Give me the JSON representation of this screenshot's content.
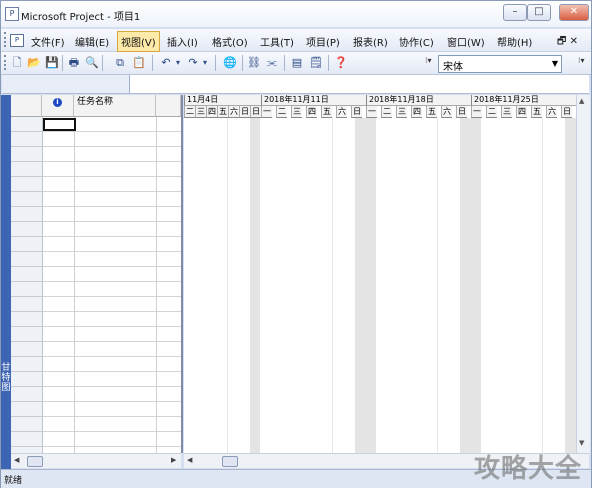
{
  "window": {
    "title": "Microsoft Project - 项目1",
    "app_icon": "ms-project-icon",
    "controls": [
      "minimize",
      "maximize",
      "close"
    ]
  },
  "menu": {
    "items": [
      {
        "label": "文件(F)"
      },
      {
        "label": "编辑(E)"
      },
      {
        "label": "视图(V)",
        "active": true
      },
      {
        "label": "插入(I)"
      },
      {
        "label": "格式(O)"
      },
      {
        "label": "工具(T)"
      },
      {
        "label": "项目(P)"
      },
      {
        "label": "报表(R)"
      },
      {
        "label": "协作(C)"
      },
      {
        "label": "窗口(W)"
      },
      {
        "label": "帮助(H)"
      }
    ],
    "mdi_controls": "🗗 ✕"
  },
  "toolbar": {
    "icons": [
      "new-icon",
      "open-icon",
      "save-icon",
      "print-icon",
      "print-preview-icon",
      "copy-icon",
      "paste-icon",
      "undo-icon",
      "redo-icon",
      "hyperlink-icon",
      "link-tasks-icon",
      "unlink-tasks-icon",
      "task-info-icon",
      "notes-icon",
      "help-icon"
    ],
    "font_name": "宋体"
  },
  "sheet": {
    "columns": {
      "indicator_icon": "info-icon",
      "task_name": "任务名称"
    }
  },
  "side_view_label": "甘特图",
  "timescale": {
    "weeks": [
      "11月4日",
      "2018年11月11日",
      "2018年11月18日",
      "2018年11月25日"
    ],
    "days": [
      "日",
      "一",
      "二",
      "三",
      "四",
      "五",
      "六"
    ]
  },
  "status": {
    "text": "就绪"
  },
  "watermark": "攻略大全"
}
